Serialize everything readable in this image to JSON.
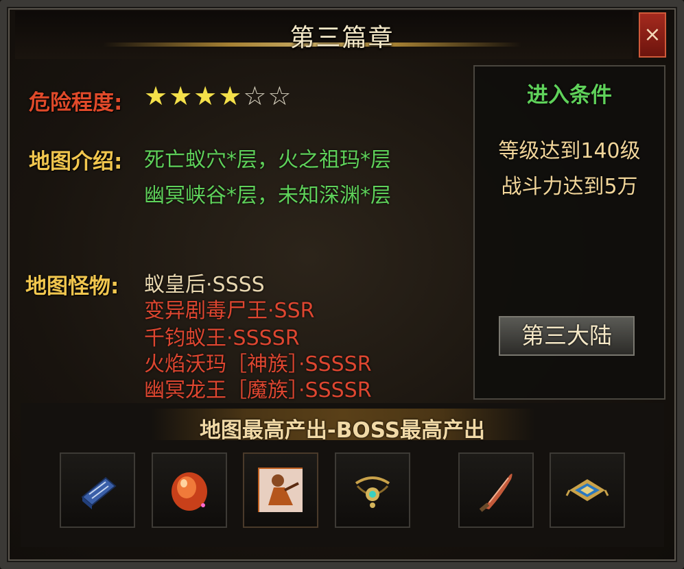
{
  "window": {
    "title": "第三篇章",
    "close_label": "×"
  },
  "info": {
    "danger_label": "危险程度:",
    "danger_rating": 4,
    "danger_max": 6,
    "map_intro_label": "地图介绍:",
    "map_intro_lines": [
      "死亡蚁穴*层，火之祖玛*层",
      "幽冥峡谷*层，未知深渊*层"
    ],
    "monsters_label": "地图怪物:",
    "monsters": [
      "蚁皇后·SSSS",
      "变异剧毒尸王·SSR",
      "千钧蚁王·SSSSR",
      "火焰沃玛［神族］·SSSSR",
      "幽冥龙王［魔族］·SSSSR"
    ]
  },
  "conditions": {
    "title": "进入条件",
    "lines": [
      "等级达到140级",
      "战斗力达到5万"
    ],
    "button_label": "第三大陆"
  },
  "drops": {
    "title": "地图最高产出-BOSS最高产出",
    "items": [
      {
        "icon": "blue-book-icon"
      },
      {
        "icon": "red-gem-icon"
      },
      {
        "icon": "warrior-portrait-icon"
      },
      {
        "icon": "gold-necklace-icon"
      },
      {
        "icon": "curved-sword-icon"
      },
      {
        "icon": "gold-armor-icon"
      }
    ]
  },
  "colors": {
    "label_gold": "#f1c64e",
    "danger_red": "#e04a2a",
    "intro_green": "#5fd15a",
    "monster_red": "#dd4630",
    "star_yellow": "#f4e04a"
  }
}
